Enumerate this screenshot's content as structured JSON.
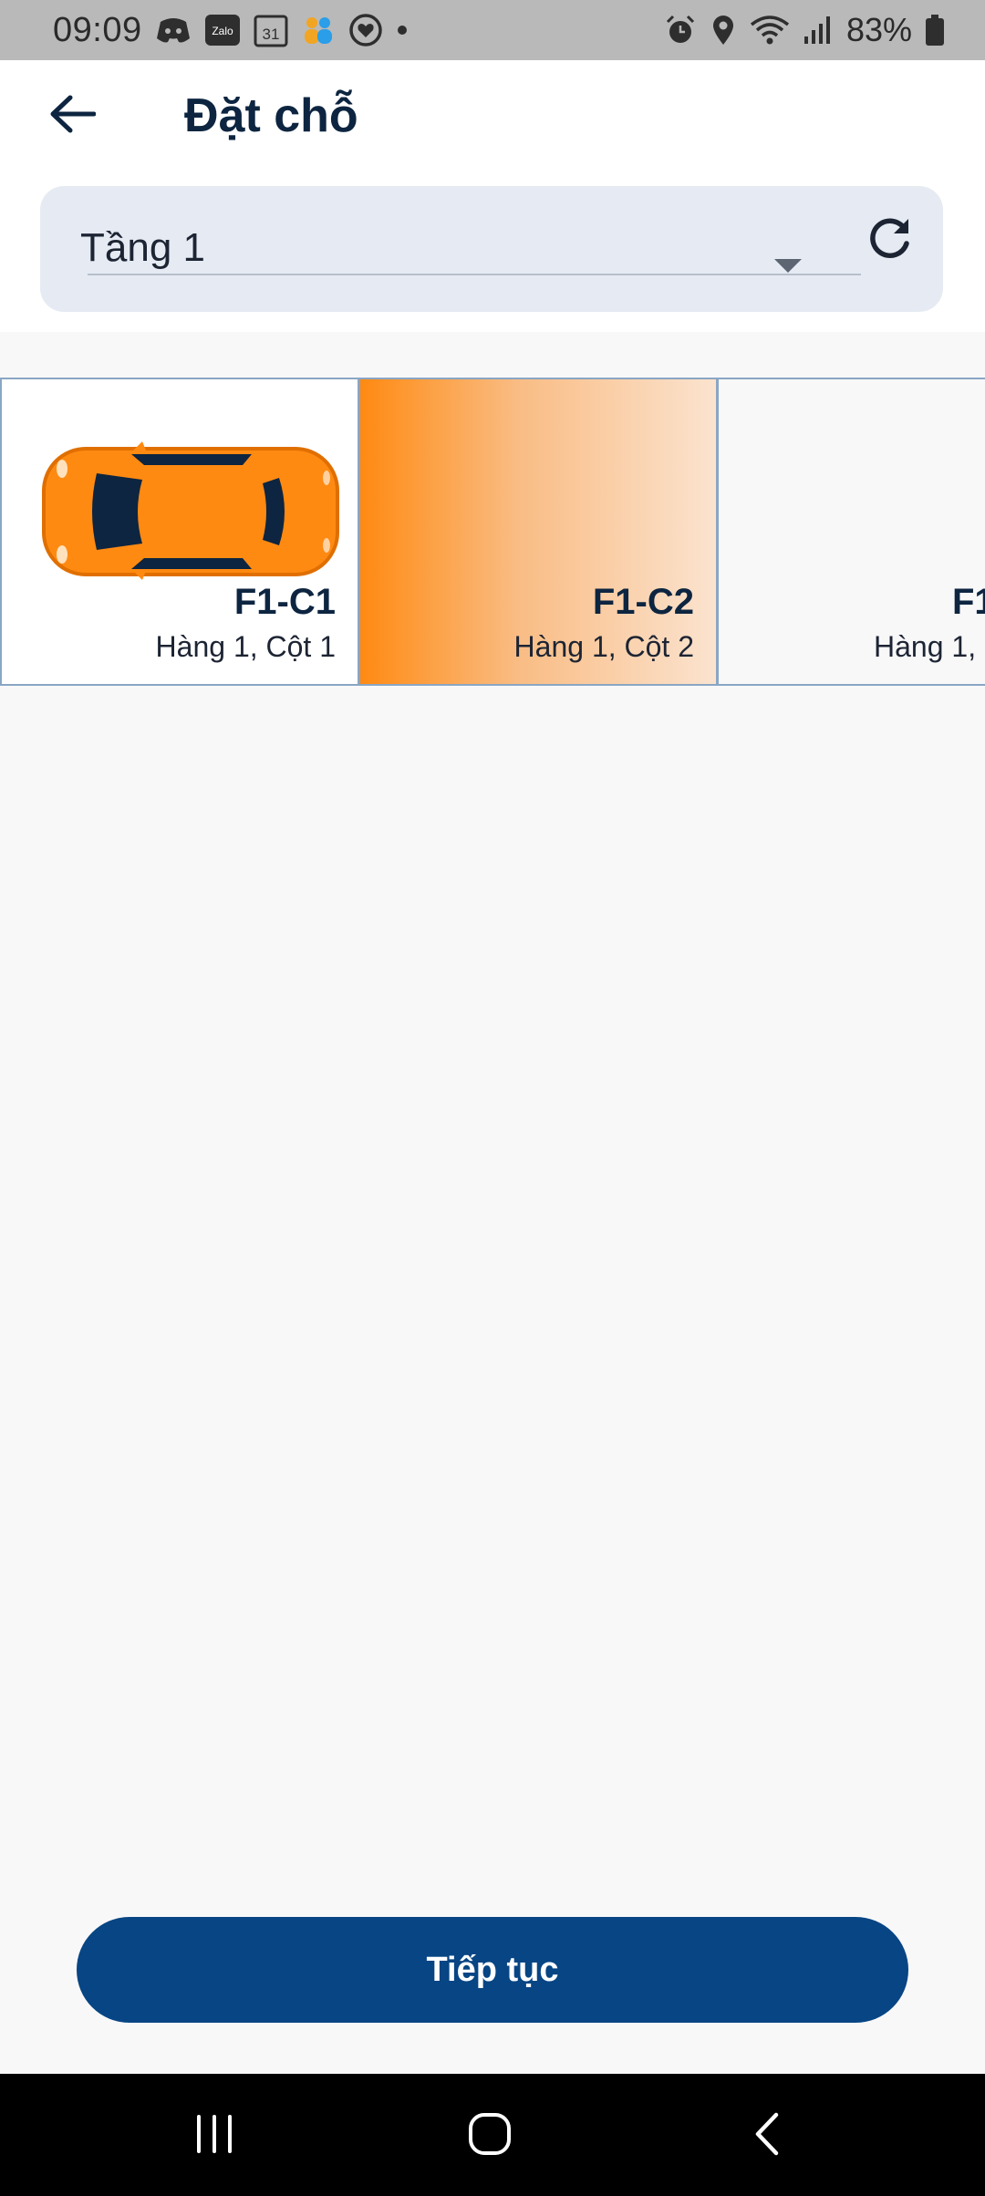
{
  "status_bar": {
    "time": "09:09",
    "battery_percent": "83%",
    "left_icons": [
      "discord-icon",
      "zalo-icon",
      "calendar-icon",
      "people-icon",
      "heart-icon",
      "dot-icon"
    ],
    "calendar_day": "31",
    "zalo_text": "Zalo",
    "right_icons": [
      "alarm-icon",
      "location-icon",
      "wifi-icon",
      "signal-icon",
      "battery-icon"
    ]
  },
  "header": {
    "title": "Đặt chỗ",
    "back_icon": "arrow-left-icon"
  },
  "floor_selector": {
    "selected": "Tầng 1",
    "dropdown_icon": "dropdown-arrow-icon",
    "refresh_icon": "refresh-icon"
  },
  "slots": [
    {
      "code": "F1-C1",
      "position": "Hàng 1, Cột 1",
      "occupied": true,
      "selected": false
    },
    {
      "code": "F1-C2",
      "position": "Hàng 1, Cột 2",
      "occupied": false,
      "selected": true
    },
    {
      "code": "F1",
      "position": "Hàng 1,",
      "occupied": false,
      "selected": false
    }
  ],
  "actions": {
    "continue_label": "Tiếp tục"
  },
  "colors": {
    "primary": "#074584",
    "accent": "#ff8a12",
    "title": "#0d2540"
  },
  "nav_bar": {
    "icons": [
      "recents-icon",
      "home-icon",
      "back-icon"
    ]
  }
}
